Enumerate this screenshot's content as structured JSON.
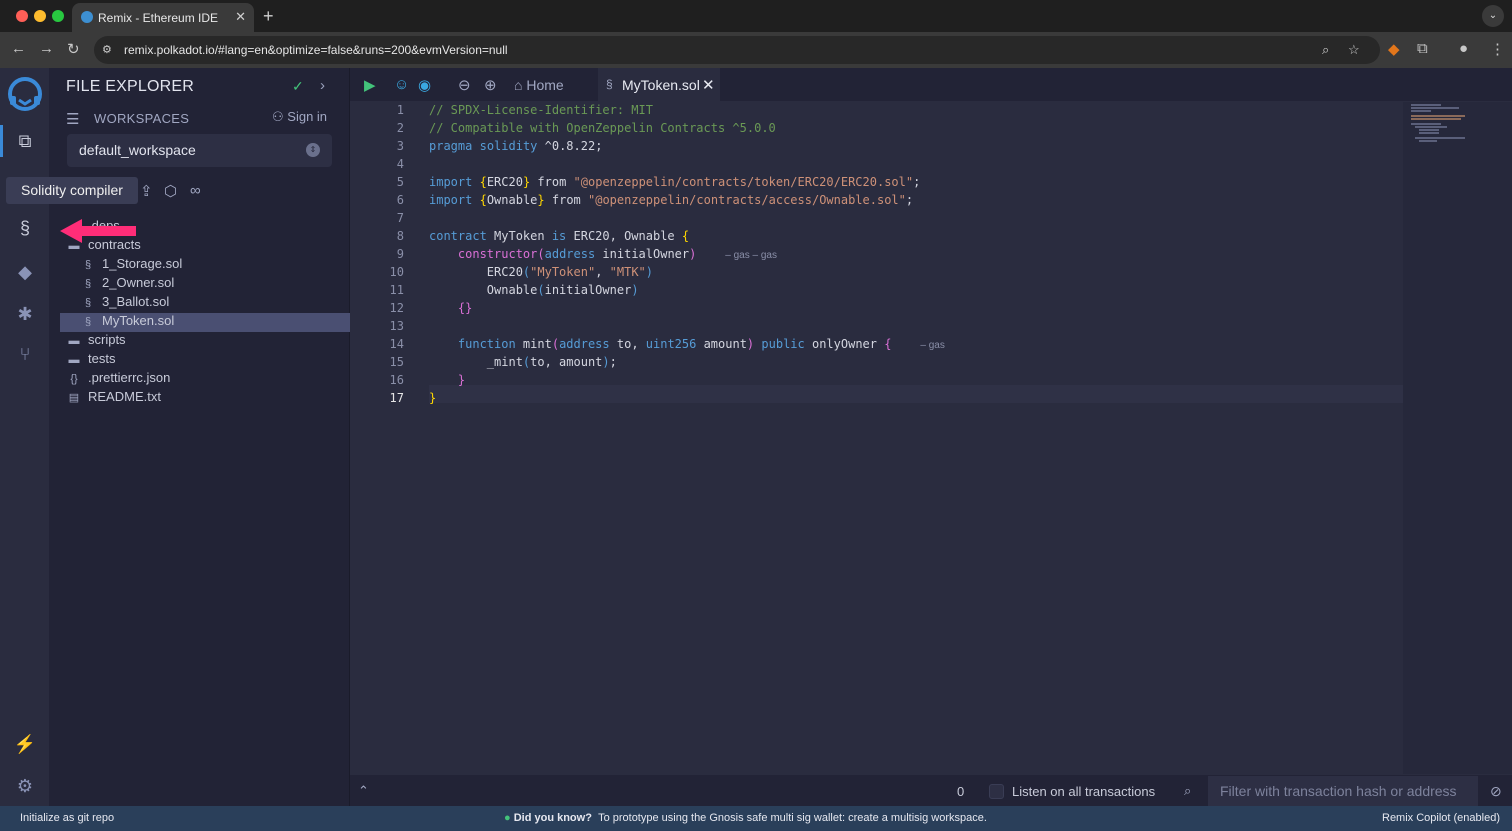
{
  "browser": {
    "tab_title": "Remix - Ethereum IDE",
    "url": "remix.polkadot.io/#lang=en&optimize=false&runs=200&evmVersion=null"
  },
  "sidepanel": {
    "title": "FILE EXPLORER",
    "workspaces_label": "WORKSPACES",
    "sign_in": "Sign in",
    "workspace": "default_workspace",
    "tree": [
      {
        "label": ".deps",
        "icon": "folder-icon"
      },
      {
        "label": "contracts",
        "icon": "folder-icon"
      },
      {
        "label": "1_Storage.sol",
        "icon": "solidity-file-icon"
      },
      {
        "label": "2_Owner.sol",
        "icon": "solidity-file-icon"
      },
      {
        "label": "3_Ballot.sol",
        "icon": "solidity-file-icon"
      },
      {
        "label": "MyToken.sol",
        "icon": "solidity-file-icon",
        "selected": true
      },
      {
        "label": "scripts",
        "icon": "folder-icon"
      },
      {
        "label": "tests",
        "icon": "folder-icon"
      },
      {
        "label": ".prettierrc.json",
        "icon": "json-file-icon"
      },
      {
        "label": "README.txt",
        "icon": "text-file-icon"
      }
    ]
  },
  "tooltip": "Solidity compiler",
  "editor": {
    "home_tab": "Home",
    "file_tab": "MyToken.sol",
    "line_numbers": [
      "1",
      "2",
      "3",
      "4",
      "5",
      "6",
      "7",
      "8",
      "9",
      "10",
      "11",
      "12",
      "13",
      "14",
      "15",
      "16",
      "17"
    ],
    "active_line": "17",
    "gas_hint_1": "– gas – gas",
    "gas_hint_2": "– gas"
  },
  "terminal": {
    "count": "0",
    "listen_label": "Listen on all transactions",
    "filter_placeholder": "Filter with transaction hash or address"
  },
  "statusbar": {
    "left": "Initialize as git repo",
    "tip_title": "Did you know?",
    "tip_text": "To prototype using the Gnosis safe multi sig wallet: create a multisig workspace.",
    "right": "Remix Copilot (enabled)"
  },
  "colors": {
    "accent": "#3a8ad8",
    "highlight_arrow": "#ff2d78",
    "status_bar": "#2a3f5a"
  }
}
